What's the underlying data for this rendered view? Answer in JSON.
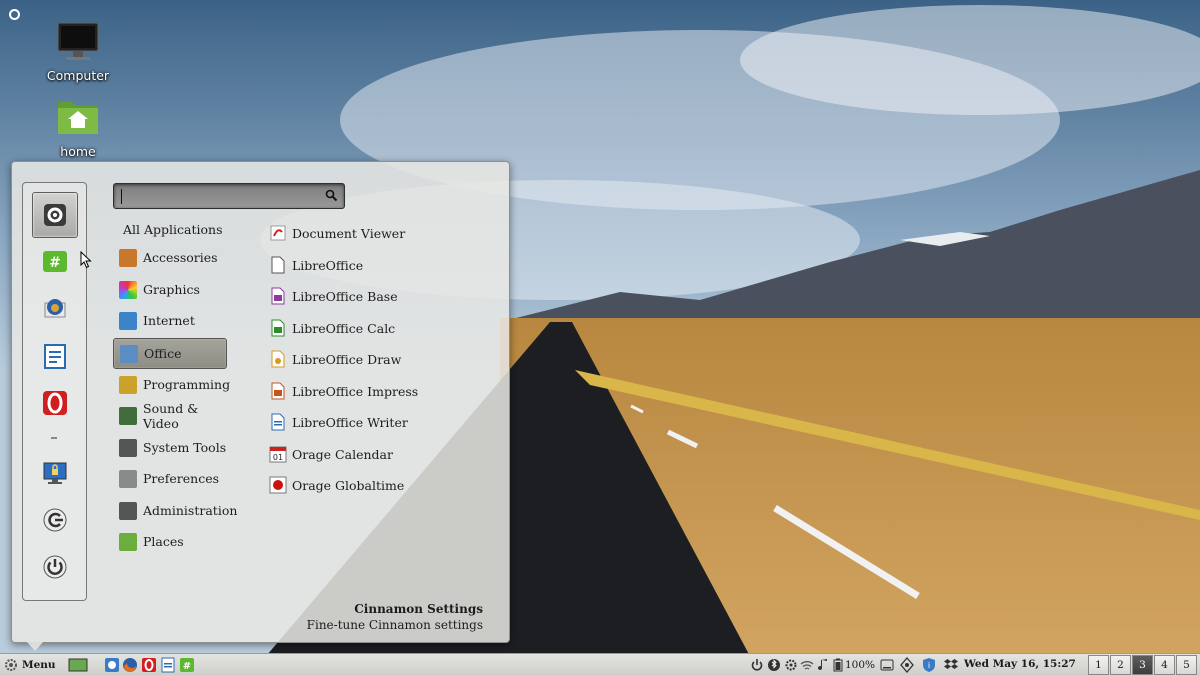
{
  "desktop": {
    "icons": [
      {
        "label": "Computer",
        "icon": "computer-icon"
      },
      {
        "label": "home",
        "icon": "home-folder-icon"
      }
    ]
  },
  "menu": {
    "search": {
      "value": "",
      "placeholder": ""
    },
    "favorites": [
      {
        "name": "fav-system-settings",
        "icon": "system-settings-icon"
      },
      {
        "name": "fav-hexchat",
        "icon": "hexchat-icon"
      },
      {
        "name": "fav-thunderbird",
        "icon": "thunderbird-icon"
      },
      {
        "name": "fav-document",
        "icon": "document-icon"
      },
      {
        "name": "fav-opera",
        "icon": "opera-icon"
      },
      {
        "name": "fav-lock-screen",
        "icon": "lock-screen-icon"
      },
      {
        "name": "fav-logout",
        "icon": "logout-icon"
      },
      {
        "name": "fav-shutdown",
        "icon": "power-icon"
      }
    ],
    "categories": [
      {
        "label": "All Applications",
        "icon": ""
      },
      {
        "label": "Accessories",
        "icon": "accessories-icon",
        "color": "#c9772b"
      },
      {
        "label": "Graphics",
        "icon": "graphics-icon",
        "color": "#d23a8c"
      },
      {
        "label": "Internet",
        "icon": "internet-icon",
        "color": "#3b84c9"
      },
      {
        "label": "Office",
        "icon": "office-icon",
        "color": "#5b8cc2"
      },
      {
        "label": "Programming",
        "icon": "programming-icon",
        "color": "#c9a12b"
      },
      {
        "label": "Sound & Video",
        "icon": "sound-video-icon",
        "color": "#3f6e3a"
      },
      {
        "label": "System Tools",
        "icon": "system-tools-icon",
        "color": "#555555"
      },
      {
        "label": "Preferences",
        "icon": "preferences-icon",
        "color": "#8a8a8a"
      },
      {
        "label": "Administration",
        "icon": "administration-icon",
        "color": "#555555"
      },
      {
        "label": "Places",
        "icon": "places-icon",
        "color": "#6cae3d"
      }
    ],
    "selected_category": "Office",
    "apps": [
      {
        "label": "Document Viewer",
        "icon": "document-viewer-icon"
      },
      {
        "label": "LibreOffice",
        "icon": "libreoffice-icon"
      },
      {
        "label": "LibreOffice Base",
        "icon": "libreoffice-base-icon"
      },
      {
        "label": "LibreOffice Calc",
        "icon": "libreoffice-calc-icon"
      },
      {
        "label": "LibreOffice Draw",
        "icon": "libreoffice-draw-icon"
      },
      {
        "label": "LibreOffice Impress",
        "icon": "libreoffice-impress-icon"
      },
      {
        "label": "LibreOffice Writer",
        "icon": "libreoffice-writer-icon"
      },
      {
        "label": "Orage Calendar",
        "icon": "orage-calendar-icon"
      },
      {
        "label": "Orage Globaltime",
        "icon": "orage-globaltime-icon"
      }
    ],
    "info": {
      "title": "Cinnamon Settings",
      "description": "Fine-tune Cinnamon settings"
    }
  },
  "panel": {
    "menu_label": "Menu",
    "battery": "100%",
    "clock": "Wed May 16, 15:27",
    "workspaces": [
      "1",
      "2",
      "3",
      "4",
      "5"
    ],
    "current_workspace": "3"
  },
  "colors": {
    "accent": "#8e8d84",
    "panel": "#dcdcd9"
  }
}
